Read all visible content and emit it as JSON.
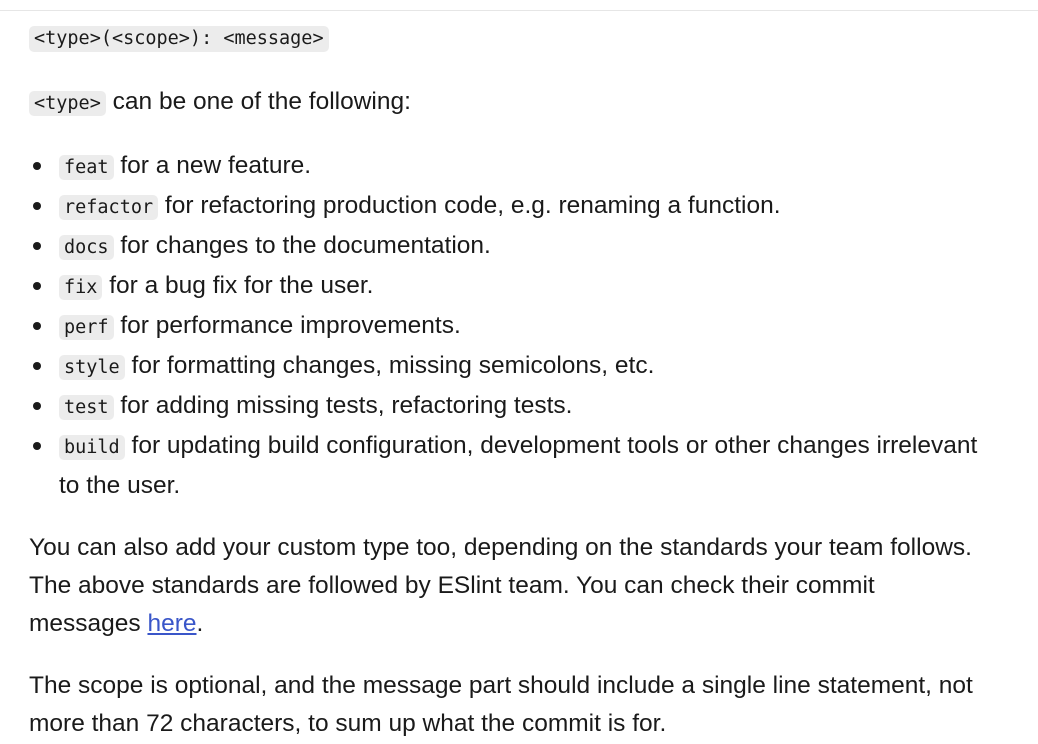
{
  "format_line": "<type>(<scope>): <message>",
  "type_intro": {
    "code": "<type>",
    "text": " can be one of the following:"
  },
  "types": [
    {
      "code": "feat",
      "desc": " for a new feature."
    },
    {
      "code": "refactor",
      "desc": " for refactoring production code, e.g. renaming a function."
    },
    {
      "code": "docs",
      "desc": " for changes to the documentation."
    },
    {
      "code": "fix",
      "desc": " for a bug fix for the user."
    },
    {
      "code": "perf",
      "desc": " for performance improvements."
    },
    {
      "code": "style",
      "desc": " for formatting changes, missing semicolons, etc."
    },
    {
      "code": "test",
      "desc": " for adding missing tests, refactoring tests."
    },
    {
      "code": "build",
      "desc": " for updating build configuration, development tools or other changes irrelevant to the user."
    }
  ],
  "custom_paragraph": {
    "text": "You can also add your custom type too, depending on the standards your team follows. The above standards are followed by ESlint team. You can check their commit messages ",
    "link_text": "here",
    "tail": "."
  },
  "scope_paragraph": "The scope is optional, and the message part should include a single line statement, not more than 72 characters, to sum up what the commit is for.",
  "colors": {
    "link": "#3a56c9",
    "code_background": "#ececec",
    "text": "#1a1a1a"
  }
}
